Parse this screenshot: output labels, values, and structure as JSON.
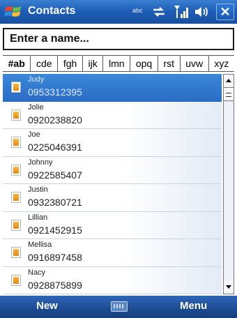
{
  "titlebar": {
    "title": "Contacts",
    "input_mode": "abc",
    "icons": [
      "windows-start-icon",
      "sync-icon",
      "signal-icon",
      "speaker-icon",
      "close-icon"
    ],
    "close_label": "✕"
  },
  "search": {
    "text": "Enter a name..."
  },
  "tabs": [
    "#ab",
    "cde",
    "fgh",
    "ijk",
    "lmn",
    "opq",
    "rst",
    "uvw",
    "xyz"
  ],
  "contacts": [
    {
      "name": "Judy",
      "phone": "0953312395",
      "selected": true
    },
    {
      "name": "Jolie",
      "phone": "0920238820"
    },
    {
      "name": "Joe",
      "phone": "0225046391"
    },
    {
      "name": "Johnny",
      "phone": "0922585407"
    },
    {
      "name": "Justin",
      "phone": "0932380721"
    },
    {
      "name": "Lillian",
      "phone": "0921452915"
    },
    {
      "name": "Mellisa",
      "phone": "0916897458"
    },
    {
      "name": "Nacy",
      "phone": "0928875899"
    }
  ],
  "softkeys": {
    "left": "New",
    "right": "Menu"
  },
  "colors": {
    "titlebar": "#1f5fb8",
    "selection": "#2a6cc4",
    "bottombar": "#1e4d95",
    "contact_icon": "#e58a12"
  }
}
